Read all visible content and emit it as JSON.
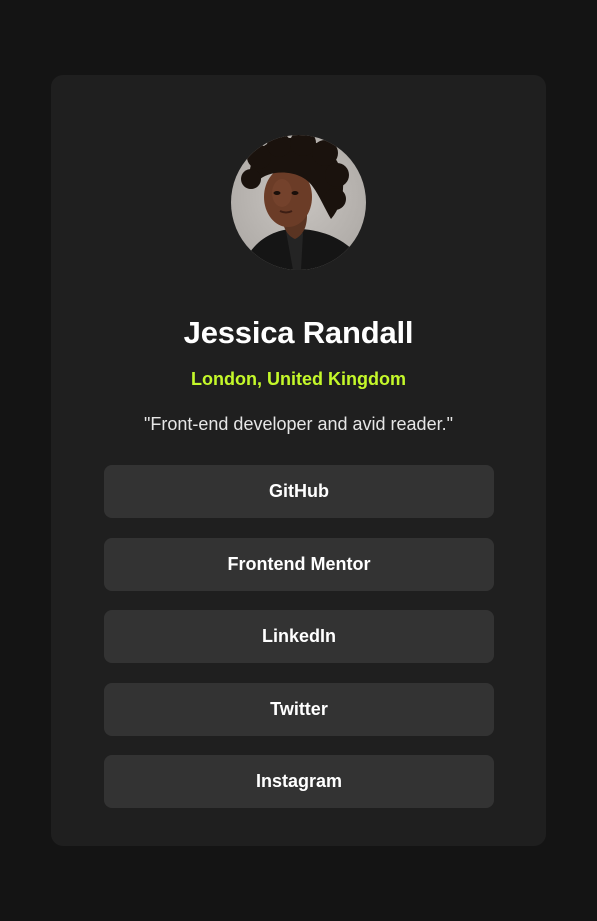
{
  "profile": {
    "name": "Jessica Randall",
    "location": "London, United Kingdom",
    "bio": "\"Front-end developer and avid reader.\"",
    "avatar_icon": "profile-photo"
  },
  "links": [
    {
      "label": "GitHub"
    },
    {
      "label": "Frontend Mentor"
    },
    {
      "label": "LinkedIn"
    },
    {
      "label": "Twitter"
    },
    {
      "label": "Instagram"
    }
  ],
  "colors": {
    "page_background": "#141414",
    "card_background": "#1f1f1f",
    "button_background": "#333333",
    "accent": "#c4f82a",
    "text": "#ffffff"
  }
}
